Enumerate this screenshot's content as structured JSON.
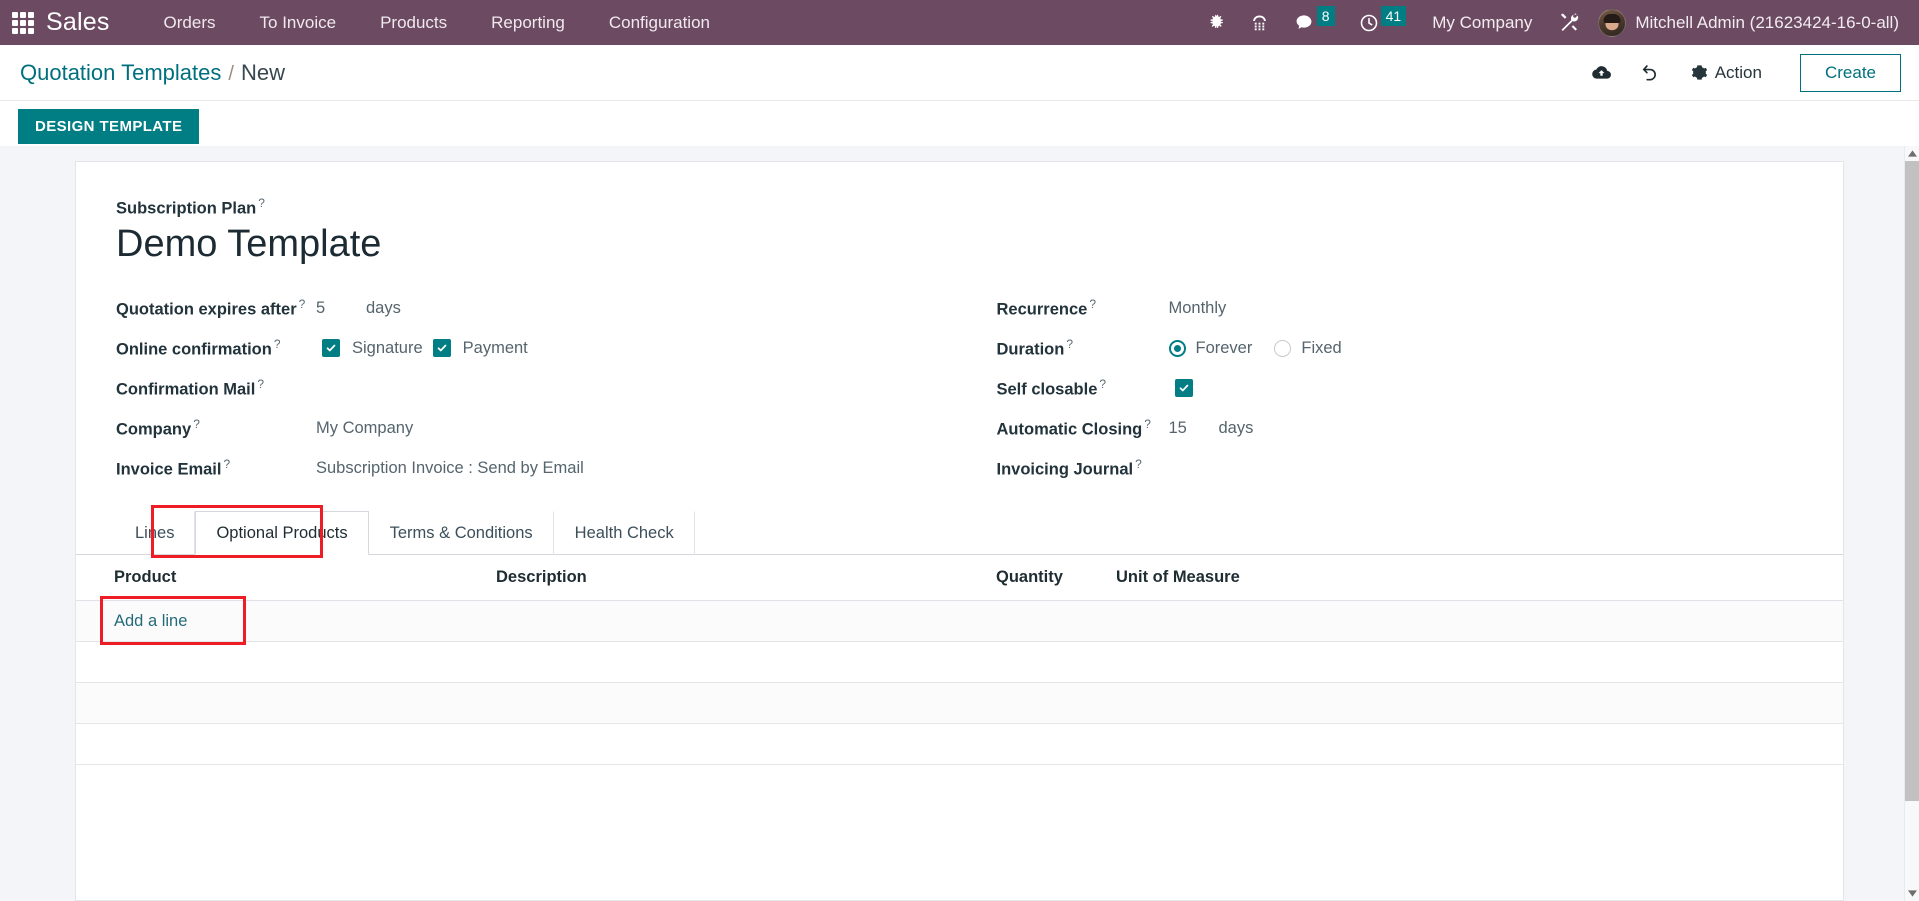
{
  "navbar": {
    "apps_icon": "apps-grid-icon",
    "brand": "Sales",
    "menu": [
      {
        "label": "Orders"
      },
      {
        "label": "To Invoice"
      },
      {
        "label": "Products"
      },
      {
        "label": "Reporting"
      },
      {
        "label": "Configuration"
      }
    ],
    "icons": [
      {
        "name": "bug-icon",
        "label": ""
      },
      {
        "name": "phone-keypad-icon",
        "label": ""
      }
    ],
    "messages_badge": "8",
    "activities_badge": "41",
    "company": "My Company",
    "tools_icon": "tools-wrench-icon",
    "user": "Mitchell Admin (21623424-16-0-all)"
  },
  "control_panel": {
    "breadcrumb_root": "Quotation Templates",
    "breadcrumb_separator": "/",
    "breadcrumb_current": "New",
    "save_icon": "cloud-upload-icon",
    "discard_icon": "undo-icon",
    "action_label": "Action",
    "action_icon": "gear-icon",
    "create_label": "Create",
    "design_template_label": "DESIGN TEMPLATE"
  },
  "form": {
    "title_label": "Subscription Plan",
    "title_value": "Demo Template",
    "left_fields": {
      "expires_label": "Quotation expires after",
      "expires_value": "5",
      "expires_unit": "days",
      "online_confirmation_label": "Online confirmation",
      "signature_label": "Signature",
      "payment_label": "Payment",
      "confirmation_mail_label": "Confirmation Mail",
      "confirmation_mail_value": "",
      "company_label": "Company",
      "company_value": "My Company",
      "invoice_email_label": "Invoice Email",
      "invoice_email_value": "Subscription Invoice : Send by Email"
    },
    "right_fields": {
      "recurrence_label": "Recurrence",
      "recurrence_value": "Monthly",
      "duration_label": "Duration",
      "duration_forever": "Forever",
      "duration_fixed": "Fixed",
      "self_closable_label": "Self closable",
      "automatic_closing_label": "Automatic Closing",
      "automatic_closing_value": "15",
      "automatic_closing_unit": "days",
      "invoicing_journal_label": "Invoicing Journal",
      "invoicing_journal_value": ""
    },
    "checkbox_states": {
      "signature": true,
      "payment": true,
      "self_closable": true
    },
    "radio_states": {
      "forever": true,
      "fixed": false
    }
  },
  "notebook": {
    "tabs": [
      {
        "label": "Lines",
        "active": false
      },
      {
        "label": "Optional Products",
        "active": true
      },
      {
        "label": "Terms & Conditions",
        "active": false
      },
      {
        "label": "Health Check",
        "active": false
      }
    ],
    "columns": [
      {
        "label": "Product"
      },
      {
        "label": "Description"
      },
      {
        "label": "Quantity"
      },
      {
        "label": "Unit of Measure"
      }
    ],
    "rows": [],
    "add_line_label": "Add a line"
  },
  "annotations": {
    "highlight_color": "#ee1c25",
    "highlighted_tab": "Optional Products",
    "highlighted_link": "Add a line"
  },
  "theme": {
    "navbar_bg": "#6b4a62",
    "accent": "#017e84",
    "link": "#00707f",
    "badge_bg": "#017e84",
    "page_bg": "#f4f5f8"
  }
}
